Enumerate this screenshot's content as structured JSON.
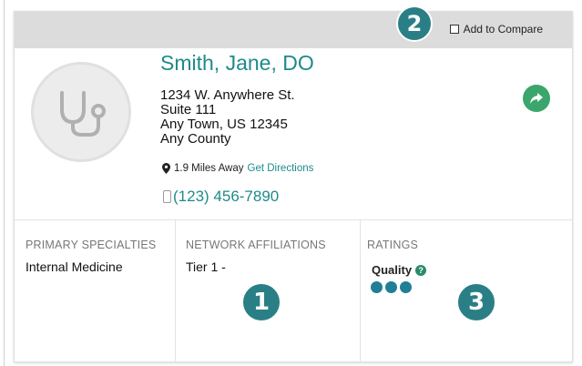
{
  "compare": {
    "label": "Add to Compare"
  },
  "badges": [
    "2",
    "1",
    "3"
  ],
  "provider": {
    "name": "Smith, Jane, DO",
    "address_line1": "1234 W. Anywhere St.",
    "address_line2": "Suite 111",
    "address_line3": "Any Town, US 12345",
    "county": "Any County",
    "distance": "1.9 Miles Away",
    "directions": "Get Directions",
    "phone": "(123) 456-7890"
  },
  "columns": {
    "specialties_label": "PRIMARY SPECIALTIES",
    "specialties_value": "Internal Medicine",
    "network_label": "NETWORK AFFILIATIONS",
    "network_value": "Tier 1 -",
    "ratings_label": "RATINGS",
    "quality_label": "Quality",
    "quality_dots": 3
  },
  "icons": [
    "stethoscope-icon",
    "map-pin-icon",
    "phone-icon",
    "share-icon",
    "help-icon",
    "checkbox-icon"
  ],
  "colors": {
    "accent": "#1f8a8a",
    "badge": "#2a7f86",
    "share": "#3aa66b",
    "rating_dot": "#1f7f94"
  }
}
